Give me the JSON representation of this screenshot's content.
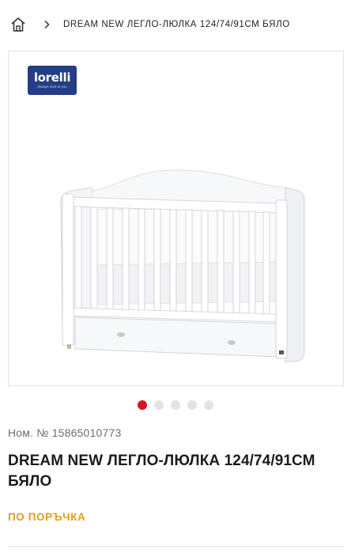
{
  "breadcrumb": {
    "home_icon": "home-icon",
    "separator_icon": "chevron-right-icon",
    "current": "DREAM NEW ЛЕГЛО-ЛЮЛКА 124/74/91СМ БЯЛО"
  },
  "gallery": {
    "brand_logo_text": "lorelli",
    "brand_logo_tagline": "Always next to you",
    "image_alt": "White crib with drawer",
    "slide_count": 5,
    "active_slide": 1,
    "accent_color": "#d8121f"
  },
  "product": {
    "sku": "Ном. № 15865010773",
    "title": "DREAM NEW ЛЕГЛО-ЛЮЛКА 124/74/91СМ БЯЛО",
    "availability": "ПО ПОРЪЧКА",
    "availability_color": "#e0a11a"
  }
}
